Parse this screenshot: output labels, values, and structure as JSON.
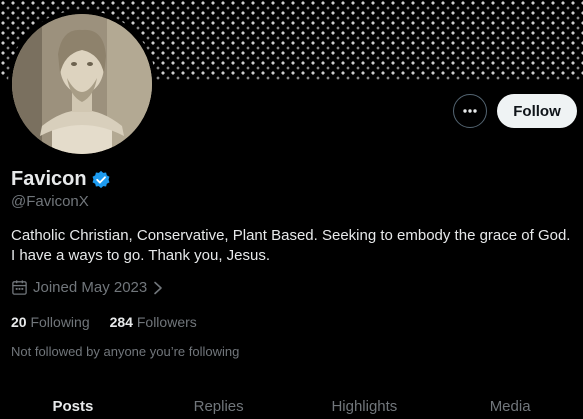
{
  "profile": {
    "name": "Favicon",
    "handle": "@FaviconX",
    "bio": "Catholic Christian, Conservative, Plant Based. Seeking to embody the grace of God. I have a ways to go. Thank you, Jesus.",
    "joined": "Joined May 2023",
    "following_count": "20",
    "following_label": "Following",
    "followers_count": "284",
    "followers_label": "Followers",
    "not_followed_text": "Not followed by anyone you’re following",
    "verified": true
  },
  "actions": {
    "follow_label": "Follow",
    "more_icon": "more-horizontal-icon"
  },
  "tabs": [
    {
      "label": "Posts",
      "active": true
    },
    {
      "label": "Replies",
      "active": false
    },
    {
      "label": "Highlights",
      "active": false
    },
    {
      "label": "Media",
      "active": false
    }
  ],
  "colors": {
    "background": "#000000",
    "text_primary": "#e7e9ea",
    "text_secondary": "#71767b",
    "verified_blue": "#1d9bf0",
    "follow_bg": "#eff3f4"
  }
}
